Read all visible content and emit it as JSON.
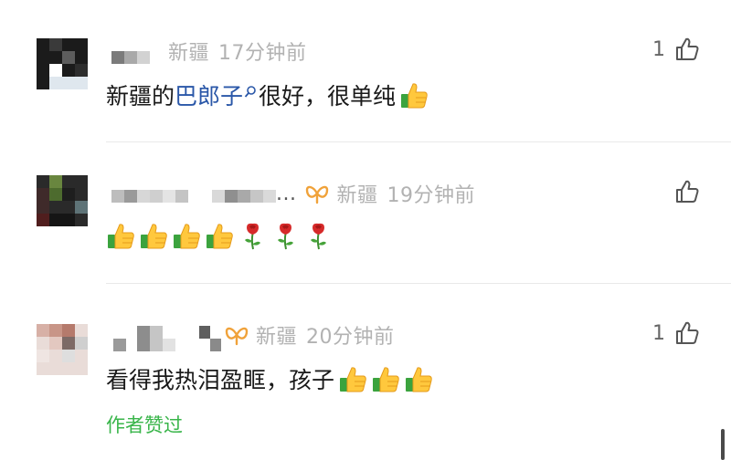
{
  "comments": [
    {
      "location": "新疆",
      "time": "17分钟前",
      "likes": "1",
      "text_before": "新疆的",
      "link_text": "巴郎子",
      "text_after": "很好，很单纯",
      "emojis": [
        "thumbs-up"
      ]
    },
    {
      "location": "新疆",
      "time": "19分钟前",
      "likes": "",
      "name_suffix": "...",
      "badge": "infinity-badge",
      "emojis": [
        "thumbs-up",
        "thumbs-up",
        "thumbs-up",
        "thumbs-up",
        "rose",
        "rose",
        "rose"
      ]
    },
    {
      "location": "新疆",
      "time": "20分钟前",
      "likes": "1",
      "badge": "infinity-badge",
      "text": "看得我热泪盈眶，孩子",
      "emojis": [
        "thumbs-up",
        "thumbs-up",
        "thumbs-up"
      ],
      "author_liked": "作者赞过"
    }
  ],
  "icons": {
    "like": "thumbs-up-outline-icon",
    "search": "search-icon"
  },
  "colors": {
    "link": "#2a57a8",
    "meta": "#b2b2b2",
    "author_liked": "#39b54a",
    "badge": "#f0a23a"
  }
}
